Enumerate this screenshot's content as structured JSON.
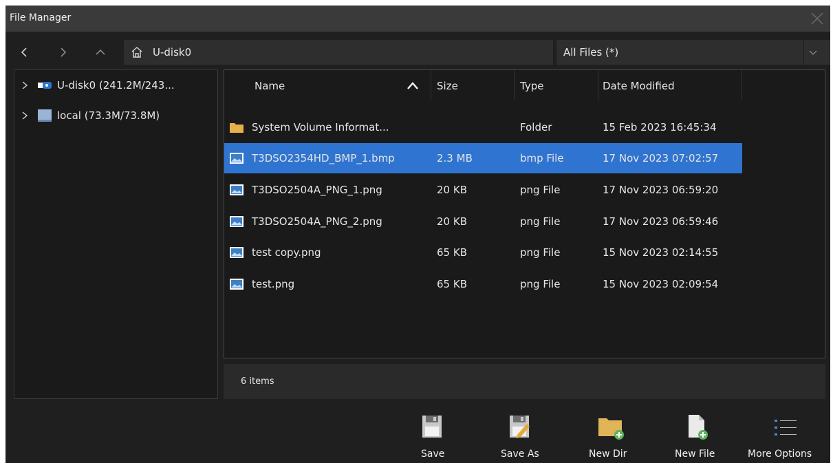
{
  "window": {
    "title": "File Manager"
  },
  "navbar": {
    "path": "U-disk0",
    "filter": "All Files (*)"
  },
  "tree": {
    "items": [
      {
        "label": "U-disk0  (241.2M/243...",
        "icon": "usb-drive-icon"
      },
      {
        "label": "local  (73.3M/73.8M)",
        "icon": "local-drive-icon"
      }
    ]
  },
  "table": {
    "columns": [
      "Name",
      "Size",
      "Type",
      "Date Modified"
    ],
    "rows": [
      {
        "name": "System Volume Informat...",
        "size": "",
        "type": "Folder",
        "date": "15 Feb 2023 16:45:34",
        "icon": "folder-icon"
      },
      {
        "name": "T3DSO2354HD_BMP_1.bmp",
        "size": "2.3 MB",
        "type": "bmp File",
        "date": "17 Nov 2023 07:02:57",
        "icon": "image-file-icon"
      },
      {
        "name": "T3DSO2504A_PNG_1.png",
        "size": "20 KB",
        "type": "png File",
        "date": "17 Nov 2023 06:59:20",
        "icon": "image-file-icon"
      },
      {
        "name": "T3DSO2504A_PNG_2.png",
        "size": "20 KB",
        "type": "png File",
        "date": "17 Nov 2023 06:59:46",
        "icon": "image-file-icon"
      },
      {
        "name": "test copy.png",
        "size": "65 KB",
        "type": "png File",
        "date": "15 Nov 2023 02:14:55",
        "icon": "image-file-icon"
      },
      {
        "name": "test.png",
        "size": "65 KB",
        "type": "png File",
        "date": "15 Nov 2023 02:09:54",
        "icon": "image-file-icon"
      }
    ]
  },
  "status": {
    "items": "6 items"
  },
  "toolbar": {
    "save": "Save",
    "save_as": "Save As",
    "new_dir": "New Dir",
    "new_file": "New File",
    "more_options": "More Options"
  },
  "colors": {
    "selection": "#2f74d0",
    "background": "#1f1f1f",
    "titlebar": "#3a3a3a"
  }
}
